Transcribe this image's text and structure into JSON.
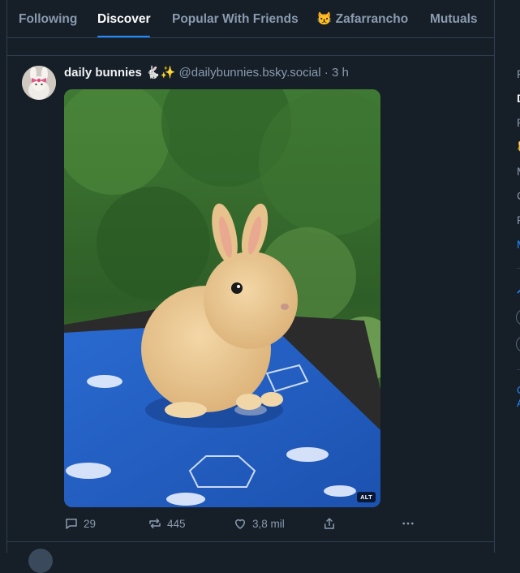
{
  "tabs": [
    {
      "label": "Following",
      "active": false
    },
    {
      "label": "Discover",
      "active": true
    },
    {
      "label": "Popular With Friends",
      "active": false
    },
    {
      "label": "😾 Zafarrancho",
      "active": false
    },
    {
      "label": "Mutuals",
      "active": false
    }
  ],
  "post": {
    "author": "daily bunnies 🐇✨",
    "handle": "@dailybunnies.bsky.social",
    "separator": "·",
    "time": "3 h",
    "image_alt_badge": "ALT",
    "image_subject": "bunny-photo",
    "actions": {
      "reply_count": "29",
      "repost_count": "445",
      "like_count": "3,8 mil"
    }
  },
  "right_sidebar": {
    "items": [
      {
        "label": "F"
      },
      {
        "label": "D",
        "bold": true
      },
      {
        "label": "P"
      },
      {
        "label": "🐱"
      },
      {
        "label": "M"
      },
      {
        "label": "C"
      },
      {
        "label": "F"
      },
      {
        "label": "M",
        "link": true
      }
    ],
    "bottom_links": [
      "C",
      "A"
    ]
  },
  "colors": {
    "background": "#161e27",
    "accent": "#208bfe",
    "border": "#2e4052",
    "muted_text": "#8a9bb0"
  }
}
